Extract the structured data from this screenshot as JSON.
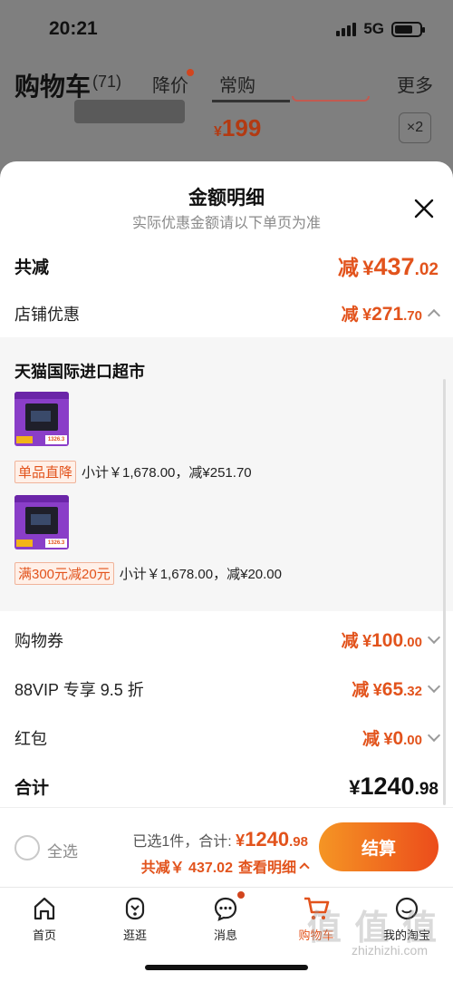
{
  "status_bar": {
    "time": "20:21",
    "network": "5G"
  },
  "cart_header": {
    "title": "购物车",
    "count": "(71)",
    "tabs": [
      {
        "label": "降价",
        "has_dot": true
      },
      {
        "label": "常购"
      }
    ],
    "more": "更多",
    "peek_price_symbol": "¥",
    "peek_price": "199",
    "peek_qty": "×2"
  },
  "sheet": {
    "title": "金额明细",
    "subtitle": "实际优惠金额请以下单页为准",
    "total_discount": {
      "label": "共减",
      "prefix": "减",
      "symbol": "¥",
      "int": "437",
      "frac": ".02"
    },
    "store_discount": {
      "label": "店铺优惠",
      "prefix": "减",
      "symbol": "¥",
      "int": "271",
      "frac": ".70"
    },
    "store": {
      "name": "天猫国际进口超市",
      "items": [
        {
          "badge": "单品直降",
          "subtotal": "小计￥1,678.00，减¥251.70"
        },
        {
          "badge": "满300元减20元",
          "subtotal": "小计￥1,678.00，减¥20.00"
        }
      ]
    },
    "coupon": {
      "label": "购物券",
      "prefix": "减",
      "symbol": "¥",
      "int": "100",
      "frac": ".00"
    },
    "vip": {
      "label": "88VIP 专享 9.5 折",
      "prefix": "减",
      "symbol": "¥",
      "int": "65",
      "frac": ".32"
    },
    "red_packet": {
      "label": "红包",
      "prefix": "减",
      "symbol": "¥",
      "int": "0",
      "frac": ".00"
    },
    "sum": {
      "label": "合计",
      "symbol": "¥",
      "int": "1240",
      "frac": ".98"
    }
  },
  "checkout": {
    "select_all": "全选",
    "selected_text": "已选1件，合计:",
    "amount_symbol": "¥",
    "amount_int": "1240",
    "amount_frac": ".98",
    "discount_text": "共减￥ 437.02",
    "details_link": "查看明细",
    "settle_label": "结算"
  },
  "tabbar": [
    {
      "label": "首页",
      "icon": "home-icon"
    },
    {
      "label": "逛逛",
      "icon": "explore-icon"
    },
    {
      "label": "消息",
      "icon": "message-icon",
      "has_dot": true
    },
    {
      "label": "购物车",
      "icon": "cart-icon",
      "active": true
    },
    {
      "label": "我的淘宝",
      "icon": "profile-icon"
    }
  ],
  "watermark": {
    "text": "值 值 值",
    "url": "zhizhizhi.com"
  },
  "colors": {
    "accent": "#e2531c",
    "button_gradient_start": "#f59524",
    "button_gradient_end": "#ec4c1b",
    "dim_overlay": "#7f7f7f"
  }
}
